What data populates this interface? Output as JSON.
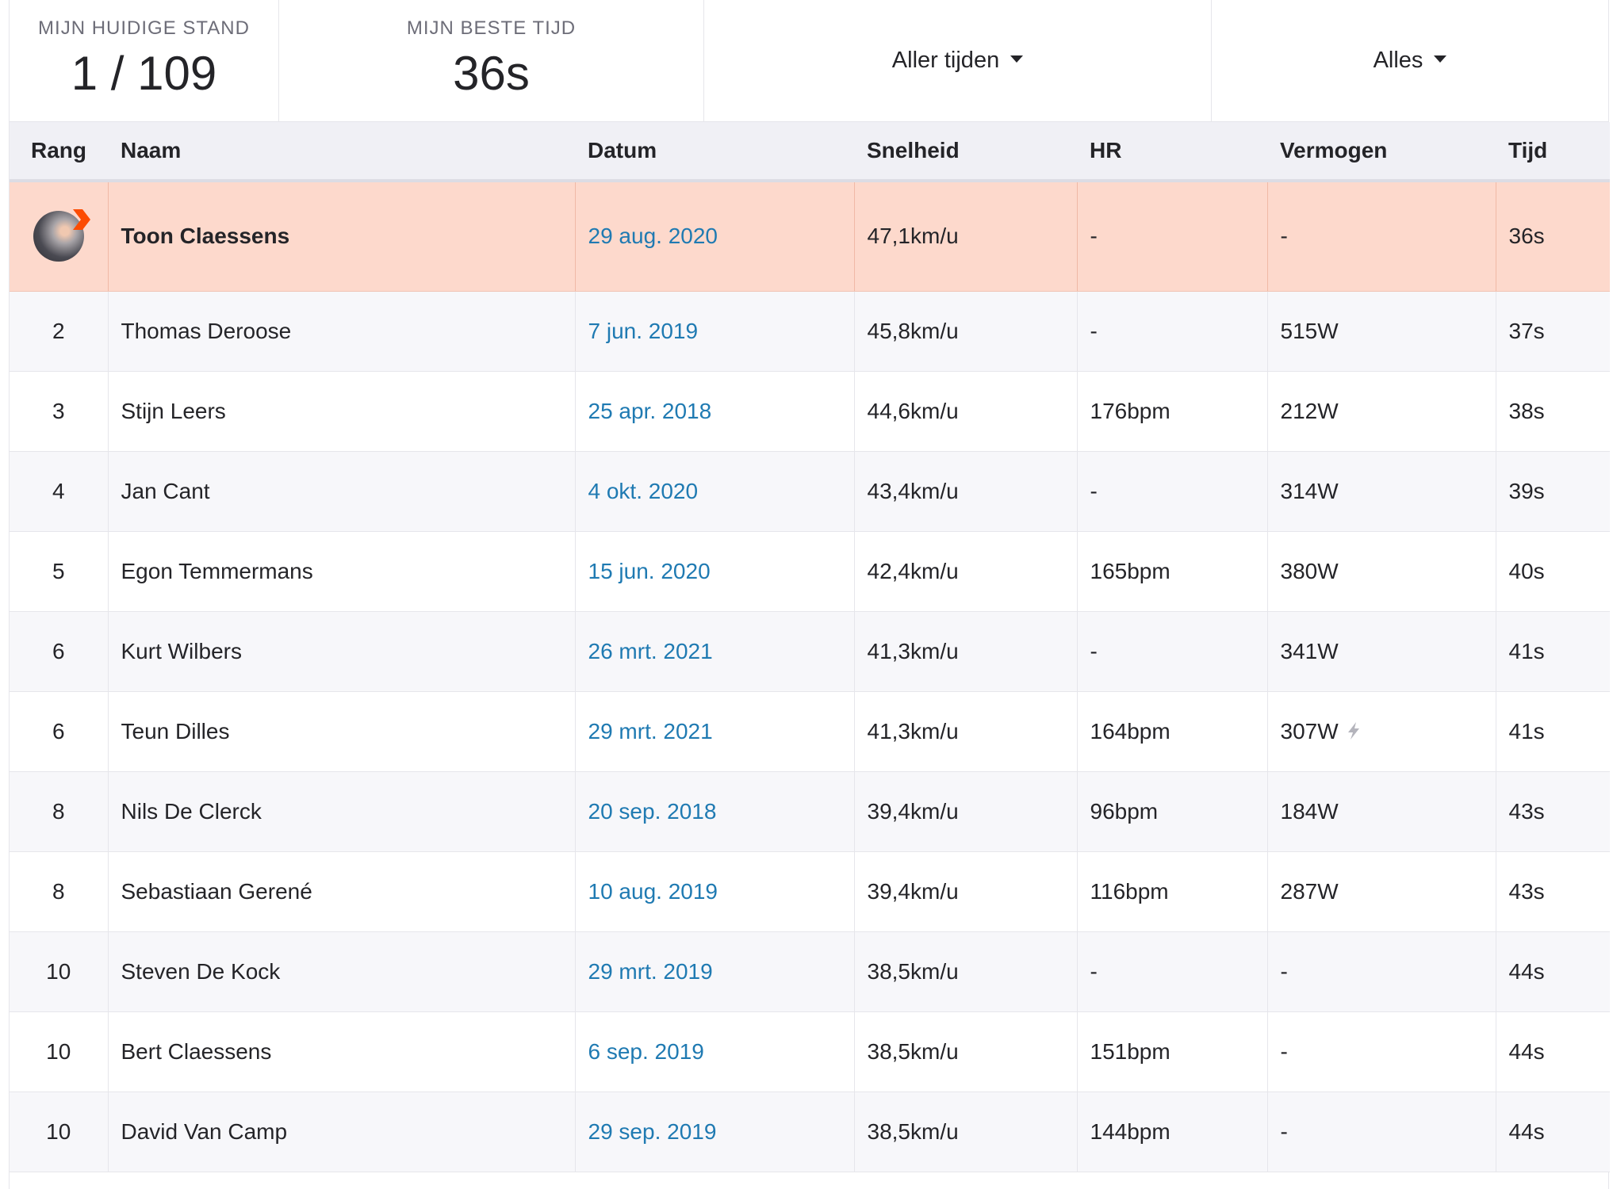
{
  "stats": {
    "current_rank_label": "MIJN HUIDIGE STAND",
    "current_rank_value": "1 / 109",
    "best_time_label": "MIJN BESTE TIJD",
    "best_time_value": "36s"
  },
  "filters": {
    "time_range": "Aller tijden",
    "scope": "Alles"
  },
  "columns": {
    "rank": "Rang",
    "name": "Naam",
    "date": "Datum",
    "speed": "Snelheid",
    "hr": "HR",
    "power": "Vermogen",
    "time": "Tijd"
  },
  "rows": [
    {
      "rank": "",
      "name": "Toon Claessens",
      "date": "29 aug. 2020",
      "speed": "47,1km/u",
      "hr": "-",
      "power": "-",
      "time": "36s"
    },
    {
      "rank": "2",
      "name": "Thomas Deroose",
      "date": "7 jun. 2019",
      "speed": "45,8km/u",
      "hr": "-",
      "power": "515W",
      "time": "37s"
    },
    {
      "rank": "3",
      "name": "Stijn Leers",
      "date": "25 apr. 2018",
      "speed": "44,6km/u",
      "hr": "176bpm",
      "power": "212W",
      "time": "38s"
    },
    {
      "rank": "4",
      "name": "Jan Cant",
      "date": "4 okt. 2020",
      "speed": "43,4km/u",
      "hr": "-",
      "power": "314W",
      "time": "39s"
    },
    {
      "rank": "5",
      "name": "Egon Temmermans",
      "date": "15 jun. 2020",
      "speed": "42,4km/u",
      "hr": "165bpm",
      "power": "380W",
      "time": "40s"
    },
    {
      "rank": "6",
      "name": "Kurt Wilbers",
      "date": "26 mrt. 2021",
      "speed": "41,3km/u",
      "hr": "-",
      "power": "341W",
      "time": "41s"
    },
    {
      "rank": "6",
      "name": "Teun Dilles",
      "date": "29 mrt. 2021",
      "speed": "41,3km/u",
      "hr": "164bpm",
      "power": "307W",
      "time": "41s"
    },
    {
      "rank": "8",
      "name": "Nils De Clerck",
      "date": "20 sep. 2018",
      "speed": "39,4km/u",
      "hr": "96bpm",
      "power": "184W",
      "time": "43s"
    },
    {
      "rank": "8",
      "name": "Sebastiaan Gerené",
      "date": "10 aug. 2019",
      "speed": "39,4km/u",
      "hr": "116bpm",
      "power": "287W",
      "time": "43s"
    },
    {
      "rank": "10",
      "name": "Steven De Kock",
      "date": "29 mrt. 2019",
      "speed": "38,5km/u",
      "hr": "-",
      "power": "-",
      "time": "44s"
    },
    {
      "rank": "10",
      "name": "Bert Claessens",
      "date": "6 sep. 2019",
      "speed": "38,5km/u",
      "hr": "151bpm",
      "power": "-",
      "time": "44s"
    },
    {
      "rank": "10",
      "name": "David Van Camp",
      "date": "29 sep. 2019",
      "speed": "38,5km/u",
      "hr": "144bpm",
      "power": "-",
      "time": "44s"
    }
  ],
  "colors": {
    "highlight_row": "#fdd9cc",
    "link": "#1f7ab2",
    "badge": "#fc4c02",
    "header_bg": "#f0f0f5"
  }
}
